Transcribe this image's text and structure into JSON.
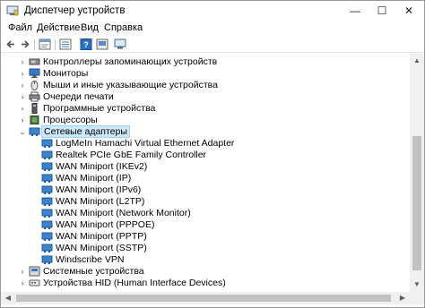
{
  "window": {
    "title": "Диспетчер устройств",
    "minimize": "—",
    "maximize": "☐",
    "close": "✕"
  },
  "menu": [
    "Файл",
    "Действие",
    "Вид",
    "Справка"
  ],
  "toolbar": [
    "back-arrow-icon",
    "forward-arrow-icon",
    "properties-icon",
    "view-icon",
    "help-icon",
    "scan-icon"
  ],
  "tree": {
    "categories_top": [
      {
        "label": "Контроллеры запоминающих устройств",
        "icon": "storage-controller-icon"
      },
      {
        "label": "Мониторы",
        "icon": "monitor-icon"
      },
      {
        "label": "Мыши и иные указывающие устройства",
        "icon": "mouse-icon"
      },
      {
        "label": "Очереди печати",
        "icon": "printer-icon"
      },
      {
        "label": "Программные устройства",
        "icon": "software-device-icon"
      },
      {
        "label": "Процессоры",
        "icon": "processor-icon"
      }
    ],
    "network": {
      "label": "Сетевые адаптеры",
      "icon": "network-adapter-icon",
      "children": [
        "LogMeIn Hamachi Virtual Ethernet Adapter",
        "Realtek PCIe GbE Family Controller",
        "WAN Miniport (IKEv2)",
        "WAN Miniport (IP)",
        "WAN Miniport (IPv6)",
        "WAN Miniport (L2TP)",
        "WAN Miniport (Network Monitor)",
        "WAN Miniport (PPPOE)",
        "WAN Miniport (PPTP)",
        "WAN Miniport (SSTP)",
        "Windscribe VPN"
      ]
    },
    "categories_bottom": [
      {
        "label": "Системные устройства",
        "icon": "system-device-icon"
      },
      {
        "label": "Устройства HID (Human Interface Devices)",
        "icon": "hid-icon"
      }
    ]
  },
  "colors": {
    "selection_bg": "#cce8ff",
    "selection_border": "#99d1ff",
    "adapter_icon": "#2f7fc8"
  }
}
